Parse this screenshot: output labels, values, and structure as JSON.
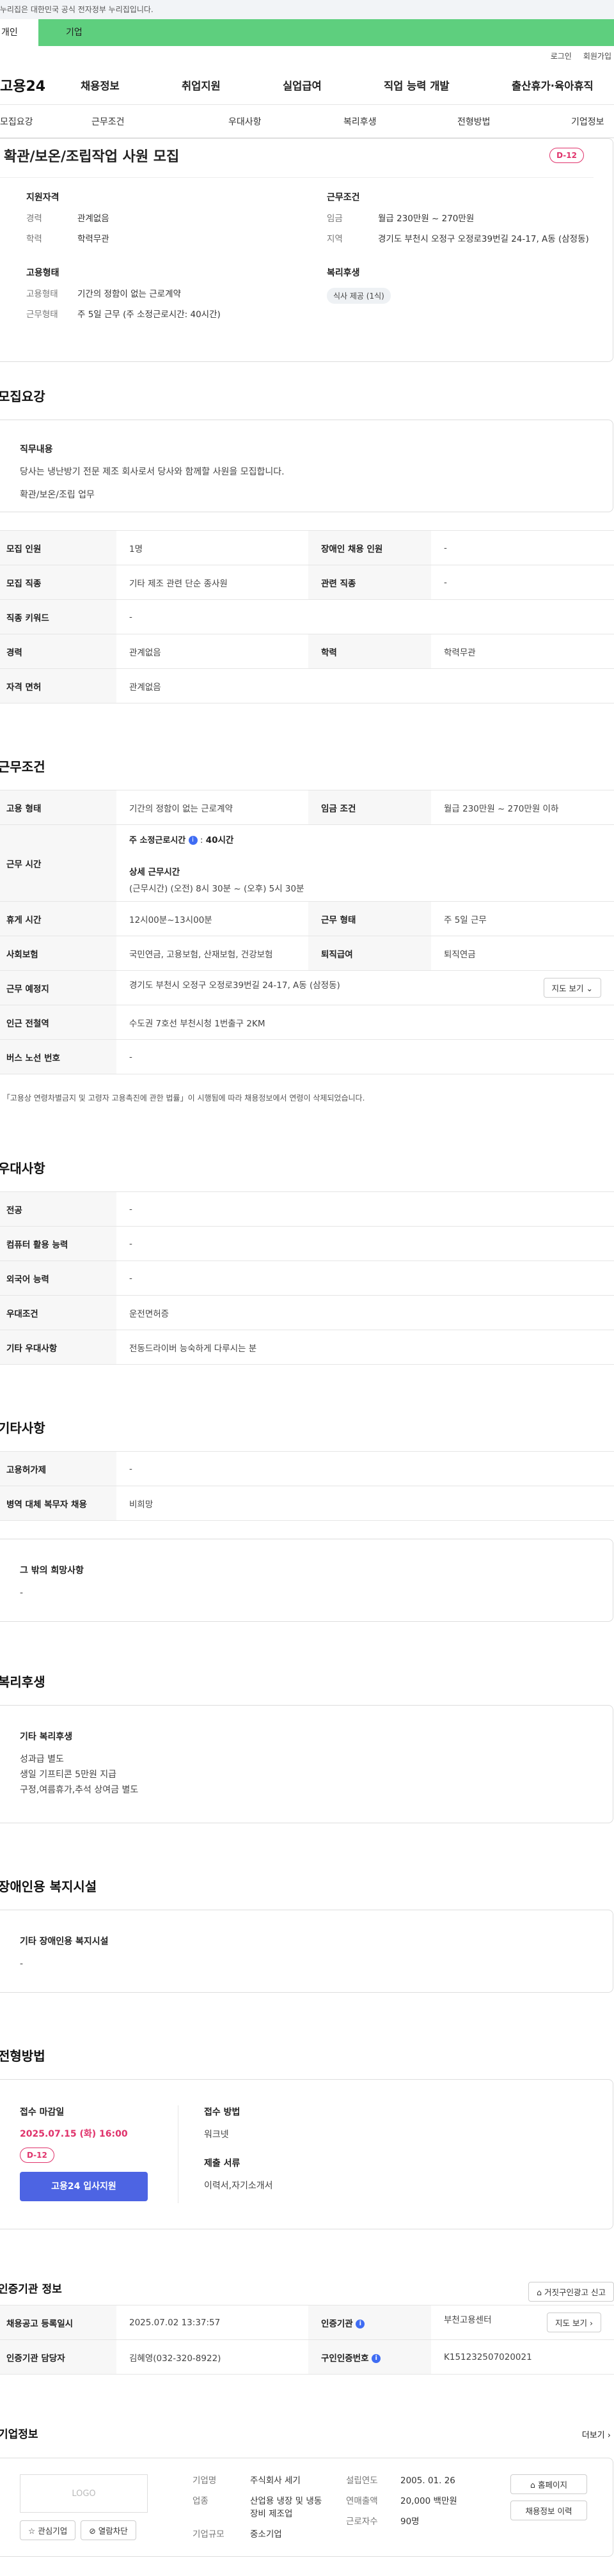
{
  "gov_banner": "이 누리집은 대한민국 공식 전자정부 누리집입니다.",
  "mode": {
    "individual": "개인",
    "enterprise": "기업"
  },
  "util": {
    "login": "로그인",
    "signup": "회원가입"
  },
  "logo": "고용24",
  "gnb": [
    "채용정보",
    "취업지원",
    "실업급여",
    "직업 능력 개발",
    "출산휴가·육아휴직"
  ],
  "tabs": [
    "모집요강",
    "근무조건",
    "우대사항",
    "복리후생",
    "전형방법",
    "기업정보"
  ],
  "job": {
    "title": "확관/보온/조립작업 사원 모집",
    "dday": "D-12"
  },
  "summary": {
    "qual_title": "지원자격",
    "career_k": "경력",
    "career_v": "관계없음",
    "edu_k": "학력",
    "edu_v": "학력무관",
    "cond_title": "근무조건",
    "wage_k": "임금",
    "wage_v": "월급 230만원 ~ 270만원",
    "loc_k": "지역",
    "loc_v": "경기도 부천시 오정구 오정로39번길 24-17, A동 (삼정동)",
    "emp_title": "고용형태",
    "type_k": "고용형태",
    "type_v": "기간의 정함이 없는 근로계약",
    "hours_k": "근무형태",
    "hours_v": "주 5일 근무 (주 소정근로시간: 40시간)",
    "welfare_title": "복리후생",
    "welfare_chip": "식사 제공 (1식)"
  },
  "recruit": {
    "title": "모집요강",
    "duty_title": "직무내용",
    "duty_text": "당사는 냉난방기 전문 제조 회사로서 당사와 함께할  사원을 모집합니다.",
    "duty_text2": "확관/보온/조립 업무",
    "rows": [
      {
        "k1": "모집 인원",
        "v1": "1명",
        "k2": "장애인 채용 인원",
        "v2": "-"
      },
      {
        "k1": "모집 직종",
        "v1": "기타 제조 관련 단순 종사원",
        "k2": "관련 직종",
        "v2": "-"
      },
      {
        "k1": "직종 키워드",
        "v1": "-"
      },
      {
        "k1": "경력",
        "v1": "관계없음",
        "k2": "학력",
        "v2": "학력무관"
      },
      {
        "k1": "자격 면허",
        "v1": "관계없음"
      }
    ]
  },
  "work": {
    "title": "근무조건",
    "emp_type_k": "고용 형태",
    "emp_type_v": "기간의 정함이 없는 근로계약",
    "wage_k": "임금 조건",
    "wage_v": "월급 230만원 ~ 270만원 이하",
    "time_k": "근무 시간",
    "time_std": "주 소정근로시간",
    "time_std_v": "40시간",
    "time_detail_t": "상세 근무시간",
    "time_detail_v": "(근무시간) (오전) 8시 30분 ~ (오후) 5시 30분",
    "rest_k": "휴게 시간",
    "rest_v": "12시00분~13시00분",
    "form_k": "근무 형태",
    "form_v": "주 5일 근무",
    "ins_k": "사회보험",
    "ins_v": "국민연금, 고용보험, 산재보험, 건강보험",
    "ret_k": "퇴직급여",
    "ret_v": "퇴직연금",
    "place_k": "근무 예정지",
    "place_v": "경기도 부천시 오정구 오정로39번길 24-17, A동 (삼정동)",
    "map_btn": "지도 보기",
    "sub_k": "인근 전철역",
    "sub_v": "수도권 7호선 부천시청 1번출구 2KM",
    "bus_k": "버스 노선 번호",
    "bus_v": "-",
    "note": "* 「고용상 연령차별금지 및 고령자 고용촉진에 관한 법률」이 시행됨에 따라 채용정보에서 연령이 삭제되었습니다."
  },
  "pref": {
    "title": "우대사항",
    "rows": [
      {
        "k": "전공",
        "v": "-"
      },
      {
        "k": "컴퓨터 활용 능력",
        "v": "-"
      },
      {
        "k": "외국어 능력",
        "v": "-"
      },
      {
        "k": "우대조건",
        "v": "운전면허증"
      },
      {
        "k": "기타 우대사항",
        "v": "전동드라이버 능숙하게 다루시는 분"
      }
    ]
  },
  "etc": {
    "title": "기타사항",
    "rows": [
      {
        "k": "고용허가제",
        "v": "-"
      },
      {
        "k": "병역 대체 복무자 채용",
        "v": "비희망"
      }
    ],
    "wish_title": "그 밖의 희망사항",
    "wish_v": "-"
  },
  "welfare": {
    "title": "복리후생",
    "sub": "기타 복리후생",
    "lines": [
      "성과급 별도",
      "생일 기프티콘 5만원 지급",
      "구정,여름휴가,추석 상여금 별도"
    ]
  },
  "disabled": {
    "title": "장애인용 복지시설",
    "sub": "기타 장애인용 복지시설",
    "v": "-"
  },
  "process": {
    "title": "전형방법",
    "deadline_t": "접수 마감일",
    "deadline_v": "2025.07.15 (화) 16:00",
    "dday": "D-12",
    "apply": "고용24 입사지원",
    "method_t": "접수 방법",
    "method_v": "워크넷",
    "docs_t": "제출 서류",
    "docs_v": "이력서,자기소개서"
  },
  "cert": {
    "title": "인증기관 정보",
    "report_btn": "거짓구인광고 신고",
    "reg_k": "채용공고 등록일시",
    "reg_v": "2025.07.02 13:37:57",
    "agency_k": "인증기관",
    "agency_v": "부천고용센터",
    "map_btn": "지도 보기",
    "mgr_k": "인증기관 담당자",
    "mgr_v": "김혜영(032-320-8922)",
    "num_k": "구인인증번호",
    "num_v": "K151232507020021"
  },
  "company": {
    "title": "기업정보",
    "more": "더보기",
    "logo": "LOGO",
    "fav": "관심기업",
    "block": "열람차단",
    "name_k": "기업명",
    "name_v": "주식회사 세기",
    "industry_k": "업종",
    "industry_v": "산업용 냉장 및 냉동 장비 제조업",
    "scale_k": "기업규모",
    "scale_v": "중소기업",
    "est_k": "설립연도",
    "est_v": "2005. 01. 26",
    "sales_k": "연매출액",
    "sales_v": "20,000 백만원",
    "emp_k": "근로자수",
    "emp_v": "90명",
    "home_btn": "홈페이지",
    "hist_btn": "채용정보 이력"
  }
}
